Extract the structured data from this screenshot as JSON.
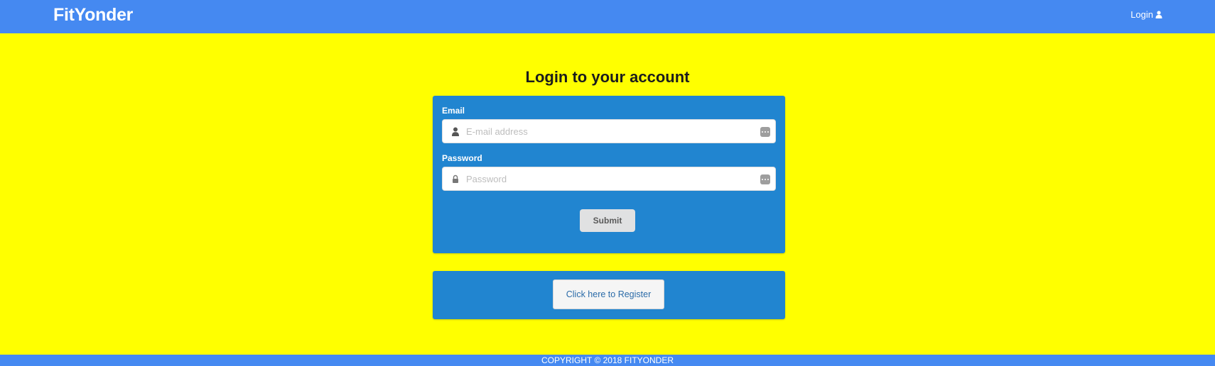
{
  "header": {
    "brand": "FitYonder",
    "login_label": "Login",
    "login_icon": "user-icon"
  },
  "main": {
    "title": "Login to your account",
    "email": {
      "label": "Email",
      "placeholder": "E-mail address",
      "value": "",
      "icon": "user-icon"
    },
    "password": {
      "label": "Password",
      "placeholder": "Password",
      "value": "",
      "icon": "lock-icon"
    },
    "submit_label": "Submit",
    "register_label": "Click here to Register"
  },
  "footer": {
    "copyright": "COPYRIGHT © 2018 FITYONDER"
  },
  "colors": {
    "background": "#ffff00",
    "header": "#4589f1",
    "panel": "#2185d0"
  }
}
